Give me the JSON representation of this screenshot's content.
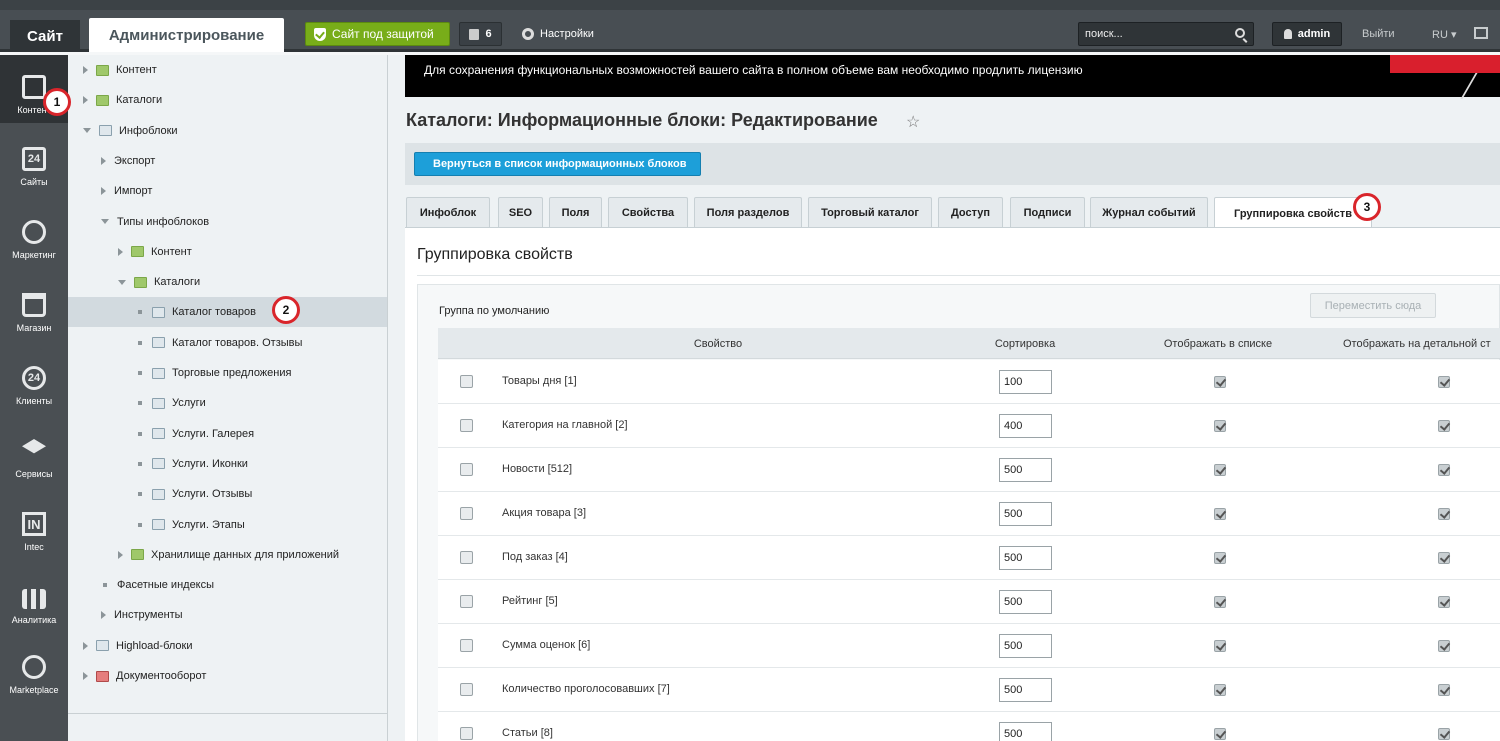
{
  "topbar": {
    "site_tab": "Сайт",
    "admin_tab": "Администрирование",
    "protect_label": "Сайт под защитой",
    "notif_count": "6",
    "settings_label": "Настройки",
    "search_placeholder": "поиск...",
    "user_label": "admin",
    "logout_label": "Выйти",
    "lang_label": "RU"
  },
  "iconbar": {
    "items": [
      {
        "label": "Контент",
        "icon": "content-icon"
      },
      {
        "label": "Сайты",
        "icon": "calendar-icon",
        "num": "24"
      },
      {
        "label": "Маркетинг",
        "icon": "target-icon"
      },
      {
        "label": "Магазин",
        "icon": "basket-icon"
      },
      {
        "label": "Клиенты",
        "icon": "clients-icon",
        "num": "24"
      },
      {
        "label": "Сервисы",
        "icon": "layers-icon"
      },
      {
        "label": "Intec",
        "icon": "intec-icon",
        "num": "IN"
      },
      {
        "label": "Аналитика",
        "icon": "analytics-icon"
      },
      {
        "label": "Marketplace",
        "icon": "cloud-icon"
      }
    ]
  },
  "tree": {
    "items": [
      {
        "label": "Контент"
      },
      {
        "label": "Каталоги"
      },
      {
        "label": "Инфоблоки"
      },
      {
        "label": "Экспорт"
      },
      {
        "label": "Импорт"
      },
      {
        "label": "Типы инфоблоков"
      },
      {
        "label": "Контент"
      },
      {
        "label": "Каталоги"
      },
      {
        "label": "Каталог товаров"
      },
      {
        "label": "Каталог товаров. Отзывы"
      },
      {
        "label": "Торговые предложения"
      },
      {
        "label": "Услуги"
      },
      {
        "label": "Услуги. Галерея"
      },
      {
        "label": "Услуги. Иконки"
      },
      {
        "label": "Услуги. Отзывы"
      },
      {
        "label": "Услуги. Этапы"
      },
      {
        "label": "Хранилище данных для приложений"
      },
      {
        "label": "Фасетные индексы"
      },
      {
        "label": "Инструменты"
      },
      {
        "label": "Highload-блоки"
      },
      {
        "label": "Документооборот"
      }
    ]
  },
  "main": {
    "banner_text": "Для сохранения функциональных возможностей вашего сайта в полном объеме вам необходимо продлить лицензию",
    "title": "Каталоги: Информационные блоки: Редактирование",
    "back_label": "Вернуться в список информационных блоков",
    "tabs": [
      {
        "label": "Инфоблок"
      },
      {
        "label": "SEO"
      },
      {
        "label": "Поля"
      },
      {
        "label": "Свойства"
      },
      {
        "label": "Поля разделов"
      },
      {
        "label": "Торговый каталог"
      },
      {
        "label": "Доступ"
      },
      {
        "label": "Подписи"
      },
      {
        "label": "Журнал событий"
      },
      {
        "label": "Группировка свойств"
      }
    ],
    "active_tab": "Группировка свойств",
    "panel_title": "Группировка свойств",
    "group_label": "Группа по умолчанию",
    "move_label": "Переместить сюда",
    "columns": [
      "Свойство",
      "Сортировка",
      "Отображать в списке",
      "Отображать на детальной ст"
    ],
    "rows": [
      {
        "name": "Товары дня [1]",
        "sort": "100",
        "in_list": true,
        "in_detail": true
      },
      {
        "name": "Категория на главной [2]",
        "sort": "400",
        "in_list": true,
        "in_detail": true
      },
      {
        "name": "Новости [512]",
        "sort": "500",
        "in_list": true,
        "in_detail": true
      },
      {
        "name": "Акция товара [3]",
        "sort": "500",
        "in_list": true,
        "in_detail": true
      },
      {
        "name": "Под заказ [4]",
        "sort": "500",
        "in_list": true,
        "in_detail": true
      },
      {
        "name": "Рейтинг [5]",
        "sort": "500",
        "in_list": true,
        "in_detail": true
      },
      {
        "name": "Сумма оценок [6]",
        "sort": "500",
        "in_list": true,
        "in_detail": true
      },
      {
        "name": "Количество проголосовавших [7]",
        "sort": "500",
        "in_list": true,
        "in_detail": true
      },
      {
        "name": "Статьи [8]",
        "sort": "500",
        "in_list": true,
        "in_detail": true
      }
    ]
  },
  "badges": [
    "1",
    "2",
    "3"
  ],
  "colors": {
    "accent_green": "#78ad19",
    "accent_blue": "#1d9fd9",
    "badge_red": "#d9252b"
  }
}
